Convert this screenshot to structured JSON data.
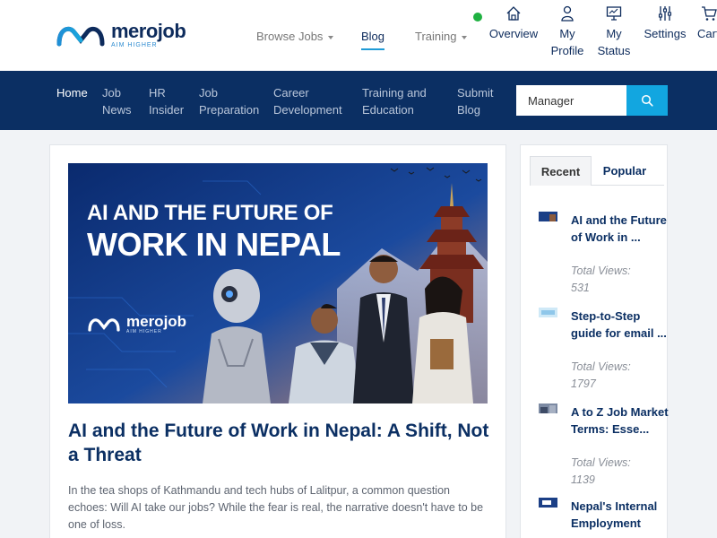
{
  "header": {
    "logo": {
      "name": "merojob",
      "tagline": "AIM HIGHER"
    },
    "nav": [
      {
        "label": "Browse Jobs",
        "dropdown": true
      },
      {
        "label": "Blog",
        "active": true
      },
      {
        "label": "Training",
        "dropdown": true
      }
    ],
    "icons": [
      {
        "label": "Overview",
        "icon": "home-icon"
      },
      {
        "label": "My Profile",
        "icon": "user-icon"
      },
      {
        "label": "My Status",
        "icon": "monitor-icon"
      },
      {
        "label": "Settings",
        "icon": "sliders-icon"
      },
      {
        "label": "Cart",
        "icon": "cart-icon"
      }
    ],
    "status_color": "#1fb141"
  },
  "main_nav": {
    "items": [
      "Home",
      "Job News",
      "HR Insider",
      "Job Preparation",
      "Career Development",
      "Training and Education",
      "Submit Blog"
    ],
    "search": {
      "value": "Manager",
      "placeholder": ""
    },
    "accent": "#12a6e0",
    "background": "#0b2f63"
  },
  "article": {
    "hero_line1": "AI AND THE FUTURE OF",
    "hero_line2": "WORK IN NEPAL",
    "hero_brand": "merojob",
    "hero_brand_tagline": "AIM HIGHER",
    "title": "AI and the Future of Work in Nepal: A Shift, Not a Threat",
    "excerpt": "In the tea shops of Kathmandu and tech hubs of Lalitpur, a common question echoes: Will AI take our jobs? While the fear is real, the narrative doesn't have to be one of loss."
  },
  "sidebar": {
    "tabs": [
      {
        "label": "Recent",
        "active": true
      },
      {
        "label": "Popular",
        "active": false
      }
    ],
    "items": [
      {
        "title": "AI and the Future of Work in ...",
        "views_label": "Total Views:",
        "views": "531"
      },
      {
        "title": "Step-to-Step guide for email ...",
        "views_label": "Total Views:",
        "views": "1797"
      },
      {
        "title": "A to Z Job Market Terms: Esse...",
        "views_label": "Total Views:",
        "views": "1139"
      },
      {
        "title": "Nepal's Internal Employment",
        "views_label": "",
        "views": ""
      }
    ]
  }
}
